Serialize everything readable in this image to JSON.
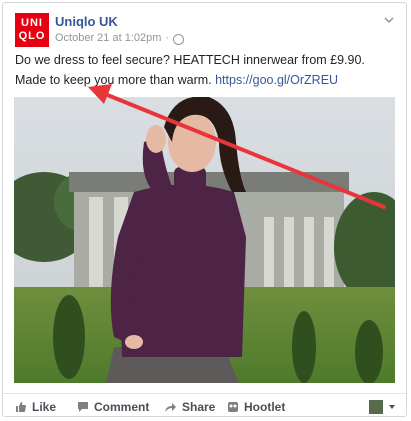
{
  "post": {
    "logo_line1": "UNI",
    "logo_line2": "QLO",
    "page_name": "Uniqlo UK",
    "timestamp": "October 21 at 1:02pm",
    "text_line1": "Do we dress to feel secure? HEATTECH innerwear from £9.90.",
    "text_line2_prefix": "Made to keep you more than warm. ",
    "link": "https://goo.gl/OrZREU"
  },
  "actions": {
    "like": "Like",
    "comment": "Comment",
    "share": "Share",
    "hootlet": "Hootlet"
  },
  "colors": {
    "brand_red": "#e60012",
    "link_blue": "#365899",
    "annotation_arrow": "#e8353a"
  }
}
